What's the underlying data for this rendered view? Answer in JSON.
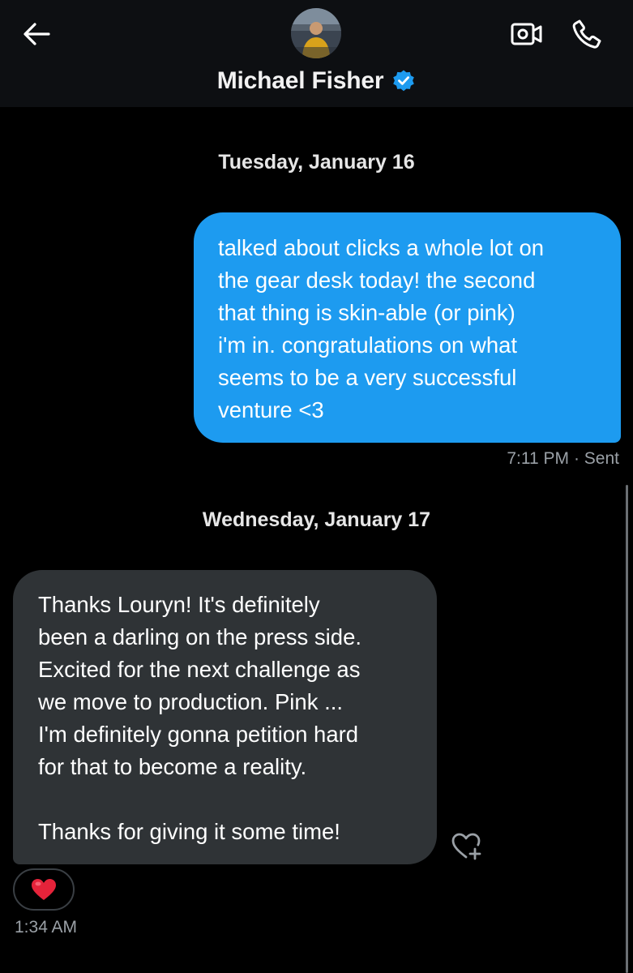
{
  "header": {
    "contact_name": "Michael Fisher",
    "verified_badge": "verified-badge-icon",
    "icons": {
      "back": "arrow-left-icon",
      "video": "video-camera-icon",
      "call": "phone-icon"
    }
  },
  "colors": {
    "outgoing_bubble": "#1d9bf0",
    "incoming_bubble": "#2f3336",
    "verified": "#1d9bf0",
    "background": "#000000",
    "header_background": "#0d0f12"
  },
  "conversation": {
    "date_1": "Tuesday, January 16",
    "message_1": {
      "direction": "outgoing",
      "text": "talked about clicks a whole lot on\nthe gear desk today! the second\nthat thing is skin-able (or pink)\ni'm in. congratulations on what\nseems to be a very successful\nventure <3",
      "time": "7:11 PM",
      "status": "· Sent"
    },
    "date_2": "Wednesday, January 17",
    "message_2": {
      "direction": "incoming",
      "text": "Thanks Louryn! It's definitely\nbeen a darling on the press side.\nExcited for the next challenge as\nwe move to production. Pink ...\nI'm definitely gonna petition hard\nfor that to become a reality.\n\nThanks for giving it some time!",
      "time": "1:34 AM",
      "reaction": "❤️",
      "add_reaction_icon": "heart-plus-icon"
    }
  }
}
